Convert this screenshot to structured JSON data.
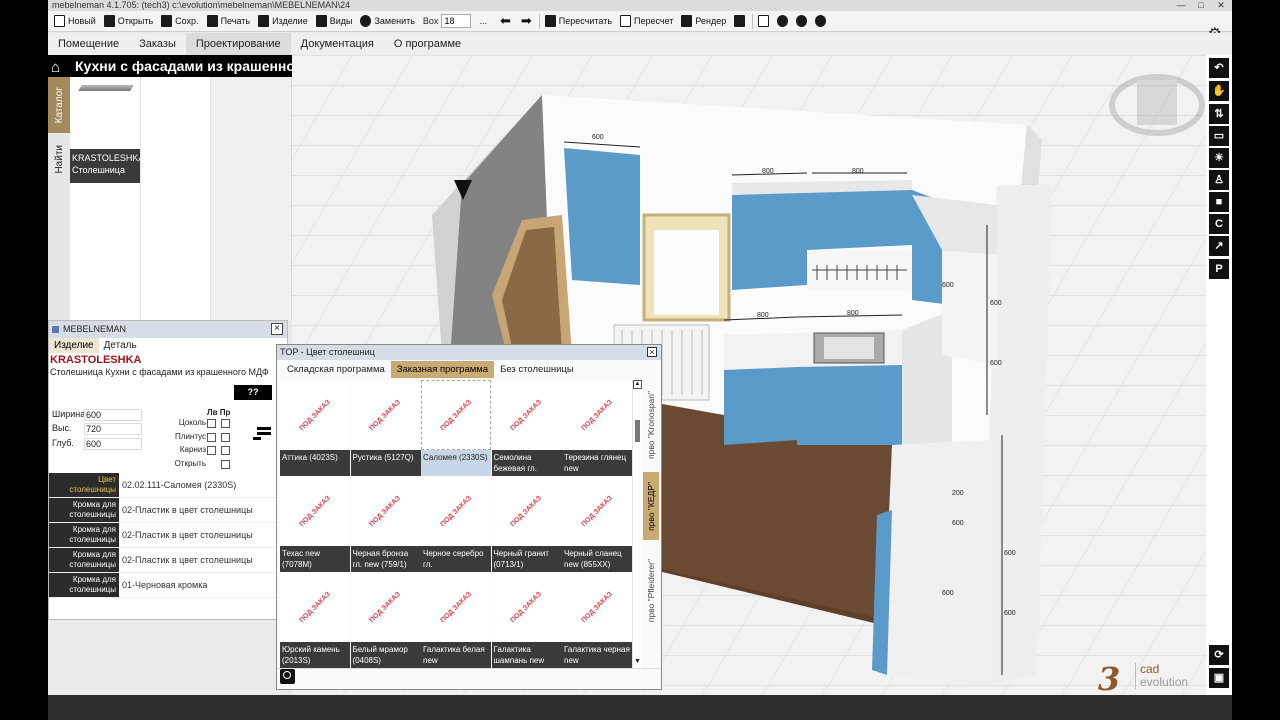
{
  "window": {
    "title": "mebelneman 4.1.705: (tech3)  c:\\evolution\\mebelneman\\MEBELNEMAN\\24",
    "controls": [
      "—",
      "□",
      "✕"
    ]
  },
  "toolbar": {
    "new": "Новый",
    "open": "Открыть",
    "save": "Сохр.",
    "print": "Печать",
    "product": "Изделие",
    "views": "Виды",
    "replace": "Заменить",
    "box_label": "Box",
    "box_value": "18",
    "more": "...",
    "recalc": "Пересчитать",
    "recount": "Пересчет",
    "render": "Рендер"
  },
  "menu": [
    "Помещение",
    "Заказы",
    "Проектирование",
    "Документация",
    "О программе"
  ],
  "catalog": {
    "title": "Кухни с фасадами из крашенного МДФ",
    "tabs": [
      "Каталог",
      "Найти"
    ],
    "item": {
      "name": "KRASTOLESHKA",
      "type": "Столешница"
    }
  },
  "panel": {
    "title": "MEBELNEMAN",
    "tabs": [
      "Изделие",
      "Деталь"
    ],
    "product_name": "KRASTOLESHKA",
    "product_desc": "Столешница Кухни с фасадами из крашенного МДФ",
    "help_button": "??",
    "dims": [
      {
        "label": "Ширина",
        "value": "600"
      },
      {
        "label": "Выс.",
        "value": "720"
      },
      {
        "label": "Глуб.",
        "value": "600"
      }
    ],
    "cb_head": "Лв Пр",
    "options": [
      "Цоколь",
      "Плинтус",
      "Карниз",
      "Открыть"
    ],
    "properties": [
      {
        "key": "Цвет столешницы",
        "value": "02.02.111-Саломея (2330S)"
      },
      {
        "key": "Кромка для столешницы",
        "value": "02-Пластик в цвет столешницы"
      },
      {
        "key": "Кромка для столешницы",
        "value": "02-Пластик в цвет столешницы"
      },
      {
        "key": "Кромка для столешницы",
        "value": "02-Пластик в цвет столешницы"
      },
      {
        "key": "Кромка для столешницы",
        "value": "01-Черновая кромка"
      }
    ]
  },
  "dialog": {
    "title": "TOP - Цвет столешниц",
    "tabs": [
      "Складская программа",
      "Заказная программа",
      "Без столешницы"
    ],
    "placeholder": "ПОД ЗАКАЗ",
    "tiles": [
      "Аттика (4023S)",
      "Рустика (5127Q)",
      "Саломея (2330S)",
      "Семолина бежевая гл.",
      "Терезина глянец new",
      "Техас new (7078M)",
      "Черная бронза гл. new (759/1)",
      "Черное серебро гл.",
      "Черный гранит (0713/1)",
      "Черный сланец new (855XX)",
      "Юрский камень (2013S)",
      "Белый мрамор (0408S)",
      "Галактика белая new",
      "Галактика шампань new",
      "Галактика черная new"
    ],
    "side_tabs": [
      "прво \"Kronospan\"",
      "прво \"КЕДР\"",
      "прво \"Pfleiderer\""
    ]
  },
  "dimensions": [
    "600",
    "800",
    "800",
    "800",
    "800",
    "600",
    "600",
    "600",
    "200",
    "600",
    "600",
    "600",
    "600"
  ],
  "logo": {
    "number": "3",
    "cad": "cad",
    "evolution": "evolution"
  },
  "right_tools": [
    "undo-icon",
    "hand-icon",
    "walk-icon",
    "ruler-icon",
    "light-icon",
    "person-icon",
    "camera-icon",
    "rotate-icon",
    "export-icon",
    "parking-icon",
    "cycle-icon",
    "screen-icon"
  ]
}
